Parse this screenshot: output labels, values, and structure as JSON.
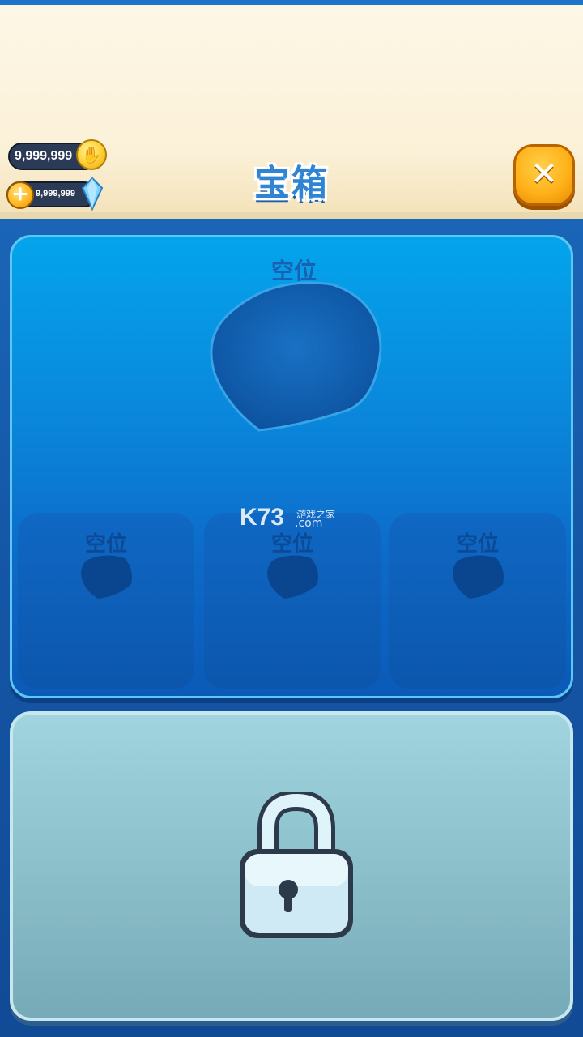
{
  "header": {
    "title": "宝箱",
    "currency_paw": "9,999,999",
    "currency_gem": "9,999,999",
    "paw_icon": "paw-coin-icon",
    "gem_icon": "gem-icon",
    "plus_icon": "plus-icon",
    "close_icon": "close-icon"
  },
  "slots": {
    "main_label": "空位",
    "small": [
      {
        "label": "空位"
      },
      {
        "label": "空位"
      },
      {
        "label": "空位"
      }
    ]
  },
  "watermark": {
    "main": "K73",
    "sub": "游戏之家",
    "sub2": ".com"
  },
  "locked_panel": {
    "icon": "lock-icon"
  },
  "colors": {
    "accent": "#2f85d4",
    "close_button": "#ffb21a"
  }
}
